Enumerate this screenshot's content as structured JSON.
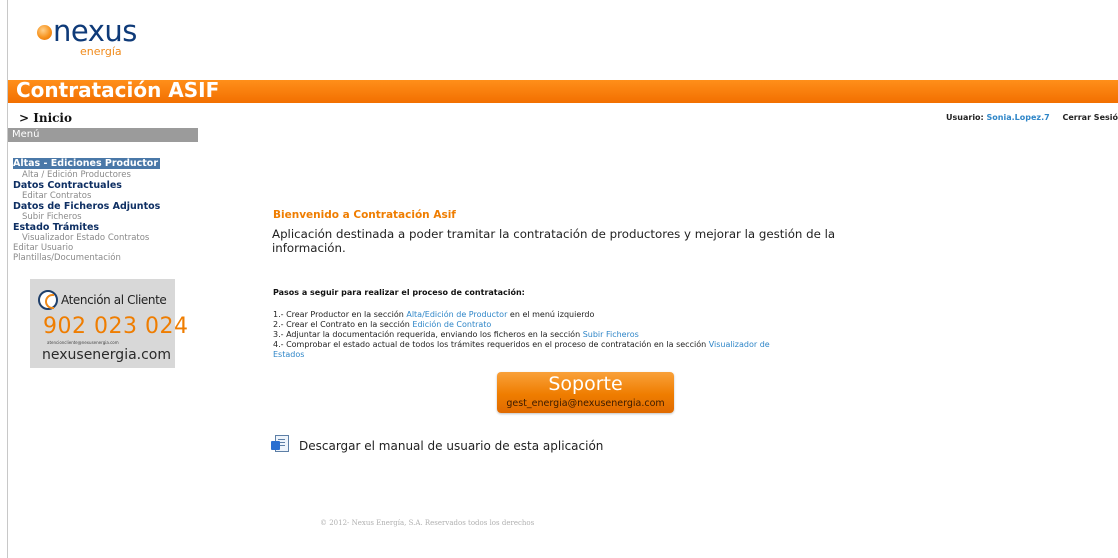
{
  "logo": {
    "word": "nexus",
    "sub": "energía"
  },
  "header": {
    "title": "Contratación ASIF"
  },
  "breadcrumb": "> Inicio",
  "user": {
    "label": "Usuario:",
    "name": "Sonia.Lopez.7",
    "logout": "Cerrar Sesió"
  },
  "sidebar": {
    "heading": "Menú",
    "sections": [
      {
        "label": "Altas - Ediciones Productor",
        "items": [
          "Alta / Edición Productores"
        ]
      },
      {
        "label": "Datos Contractuales",
        "items": [
          "Editar Contratos"
        ]
      },
      {
        "label": "Datos de Ficheros Adjuntos",
        "items": [
          "Subir Ficheros"
        ]
      },
      {
        "label": "Estado Trámites",
        "items": [
          "Visualizador Estado Contratos"
        ]
      }
    ],
    "extra": [
      "Editar Usuario",
      "Plantillas/Documentación"
    ]
  },
  "support_card": {
    "label": "Atención al Cliente",
    "phone": "902 023 024",
    "email": "atencioncliente@nexusenergia.com",
    "web": "nexusenergia.com"
  },
  "main": {
    "welcome": "Bienvenido a Contratación Asif",
    "intro": "Aplicación destinada a poder tramitar la contratación de productores y mejorar la gestión de la información.",
    "steps_title": "Pasos a seguir para realizar el proceso de contratación:",
    "steps": [
      {
        "pre": "1.- Crear Productor en la sección ",
        "link": "Alta/Edición de Productor",
        "post": " en el menú izquierdo"
      },
      {
        "pre": "2.- Crear el Contrato en la sección ",
        "link": "Edición de Contrato",
        "post": ""
      },
      {
        "pre": "3.- Adjuntar la documentación requerida, enviando los ficheros en la sección ",
        "link": "Subir Ficheros",
        "post": ""
      },
      {
        "pre": "4.- Comprobar el estado actual de todos los trámites requeridos en el proceso de contratación en la sección ",
        "link": "Visualizador de",
        "link2": "Estados"
      }
    ],
    "support_button": {
      "title": "Soporte",
      "email": "gest_energia@nexusenergia.com"
    },
    "download": "Descargar el manual de usuario de esta aplicación"
  },
  "footer": "© 2012- Nexus Energía, S.A. Reservados todos los derechos"
}
